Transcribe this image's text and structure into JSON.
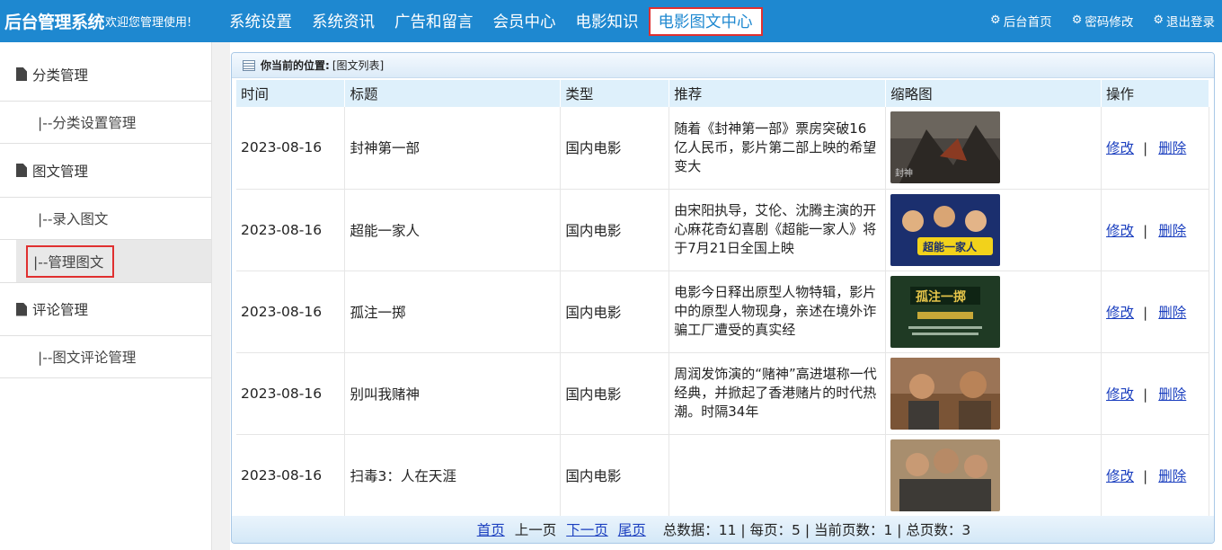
{
  "header": {
    "brand": "后台管理系统",
    "welcome": "欢迎您管理使用!",
    "nav": [
      "系统设置",
      "系统资讯",
      "广告和留言",
      "会员中心",
      "电影知识",
      "电影图文中心"
    ],
    "active_nav": "电影图文中心",
    "links": [
      {
        "icon": "gear-icon",
        "label": "后台首页"
      },
      {
        "icon": "gear-icon",
        "label": "密码修改"
      },
      {
        "icon": "gear-icon",
        "label": "退出登录"
      }
    ]
  },
  "sidebar": {
    "groups": [
      {
        "title": "分类管理",
        "items": [
          "|--分类设置管理"
        ]
      },
      {
        "title": "图文管理",
        "items": [
          "|--录入图文",
          "|--管理图文"
        ]
      },
      {
        "title": "评论管理",
        "items": [
          "|--图文评论管理"
        ]
      }
    ],
    "selected": "|--管理图文"
  },
  "location": {
    "label": "你当前的位置:",
    "value": "[图文列表]"
  },
  "table": {
    "headers": [
      "时间",
      "标题",
      "类型",
      "推荐",
      "缩略图",
      "操作"
    ],
    "rows": [
      {
        "date": "2023-08-16",
        "title": "封神第一部",
        "type": "国内电影",
        "rec": "随着《封神第一部》票房突破16亿人民币，影片第二部上映的希望变大",
        "thumb": "thumb-fengshen"
      },
      {
        "date": "2023-08-16",
        "title": "超能一家人",
        "type": "国内电影",
        "rec": "由宋阳执导，艾伦、沈腾主演的开心麻花奇幻喜剧《超能一家人》将于7月21日全国上映",
        "thumb": "thumb-chaoneng"
      },
      {
        "date": "2023-08-16",
        "title": "孤注一掷",
        "type": "国内电影",
        "rec": "电影今日释出原型人物特辑，影片中的原型人物现身，亲述在境外诈骗工厂遭受的真实经",
        "thumb": "thumb-guzhu"
      },
      {
        "date": "2023-08-16",
        "title": "别叫我赌神",
        "type": "国内电影",
        "rec": "周润发饰演的“赌神”高进堪称一代经典，并掀起了香港赌片的时代热潮。时隔34年",
        "thumb": "thumb-dushen"
      },
      {
        "date": "2023-08-16",
        "title": "扫毒3：人在天涯",
        "type": "国内电影",
        "rec": "",
        "thumb": "thumb-saodu"
      }
    ],
    "edit_label": "修改",
    "sep": "|",
    "delete_label": "删除"
  },
  "pager": {
    "first": "首页",
    "prev": "上一页",
    "next": "下一页",
    "last": "尾页",
    "info": "总数据：11 | 每页：5 | 当前页数：1 | 总页数：3"
  }
}
